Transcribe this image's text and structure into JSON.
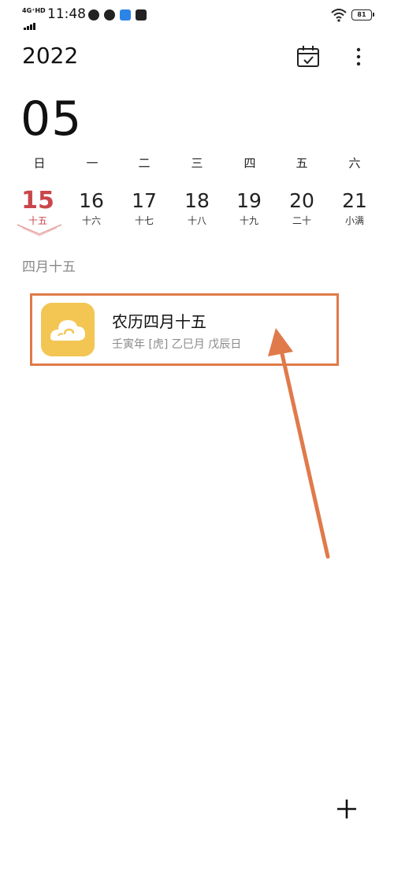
{
  "status_bar": {
    "network": "4G⁺HD",
    "time": "11:48",
    "battery": "81",
    "icons": [
      "compass-icon",
      "wechat-icon",
      "app-icon",
      "video-icon",
      "wifi-icon"
    ]
  },
  "header": {
    "year": "2022",
    "month": "05",
    "today_icon": "calendar-check-icon",
    "more_icon": "more-vert-icon"
  },
  "week": {
    "weekdays": [
      "日",
      "一",
      "二",
      "三",
      "四",
      "五",
      "六"
    ],
    "days": [
      {
        "num": "15",
        "lunar": "十五",
        "selected": true
      },
      {
        "num": "16",
        "lunar": "十六"
      },
      {
        "num": "17",
        "lunar": "十七"
      },
      {
        "num": "18",
        "lunar": "十八"
      },
      {
        "num": "19",
        "lunar": "十九"
      },
      {
        "num": "20",
        "lunar": "二十"
      },
      {
        "num": "21",
        "lunar": "小满"
      }
    ]
  },
  "section_label": "四月十五",
  "event": {
    "title": "农历四月十五",
    "subtitle": "壬寅年 [虎] 乙巳月 戊辰日",
    "icon": "auspicious-cloud-icon"
  },
  "fab_icon": "add-icon",
  "colors": {
    "accent_red": "#c9464a",
    "annotation_orange": "#e07a4a",
    "event_icon_bg": "#f3c654"
  }
}
